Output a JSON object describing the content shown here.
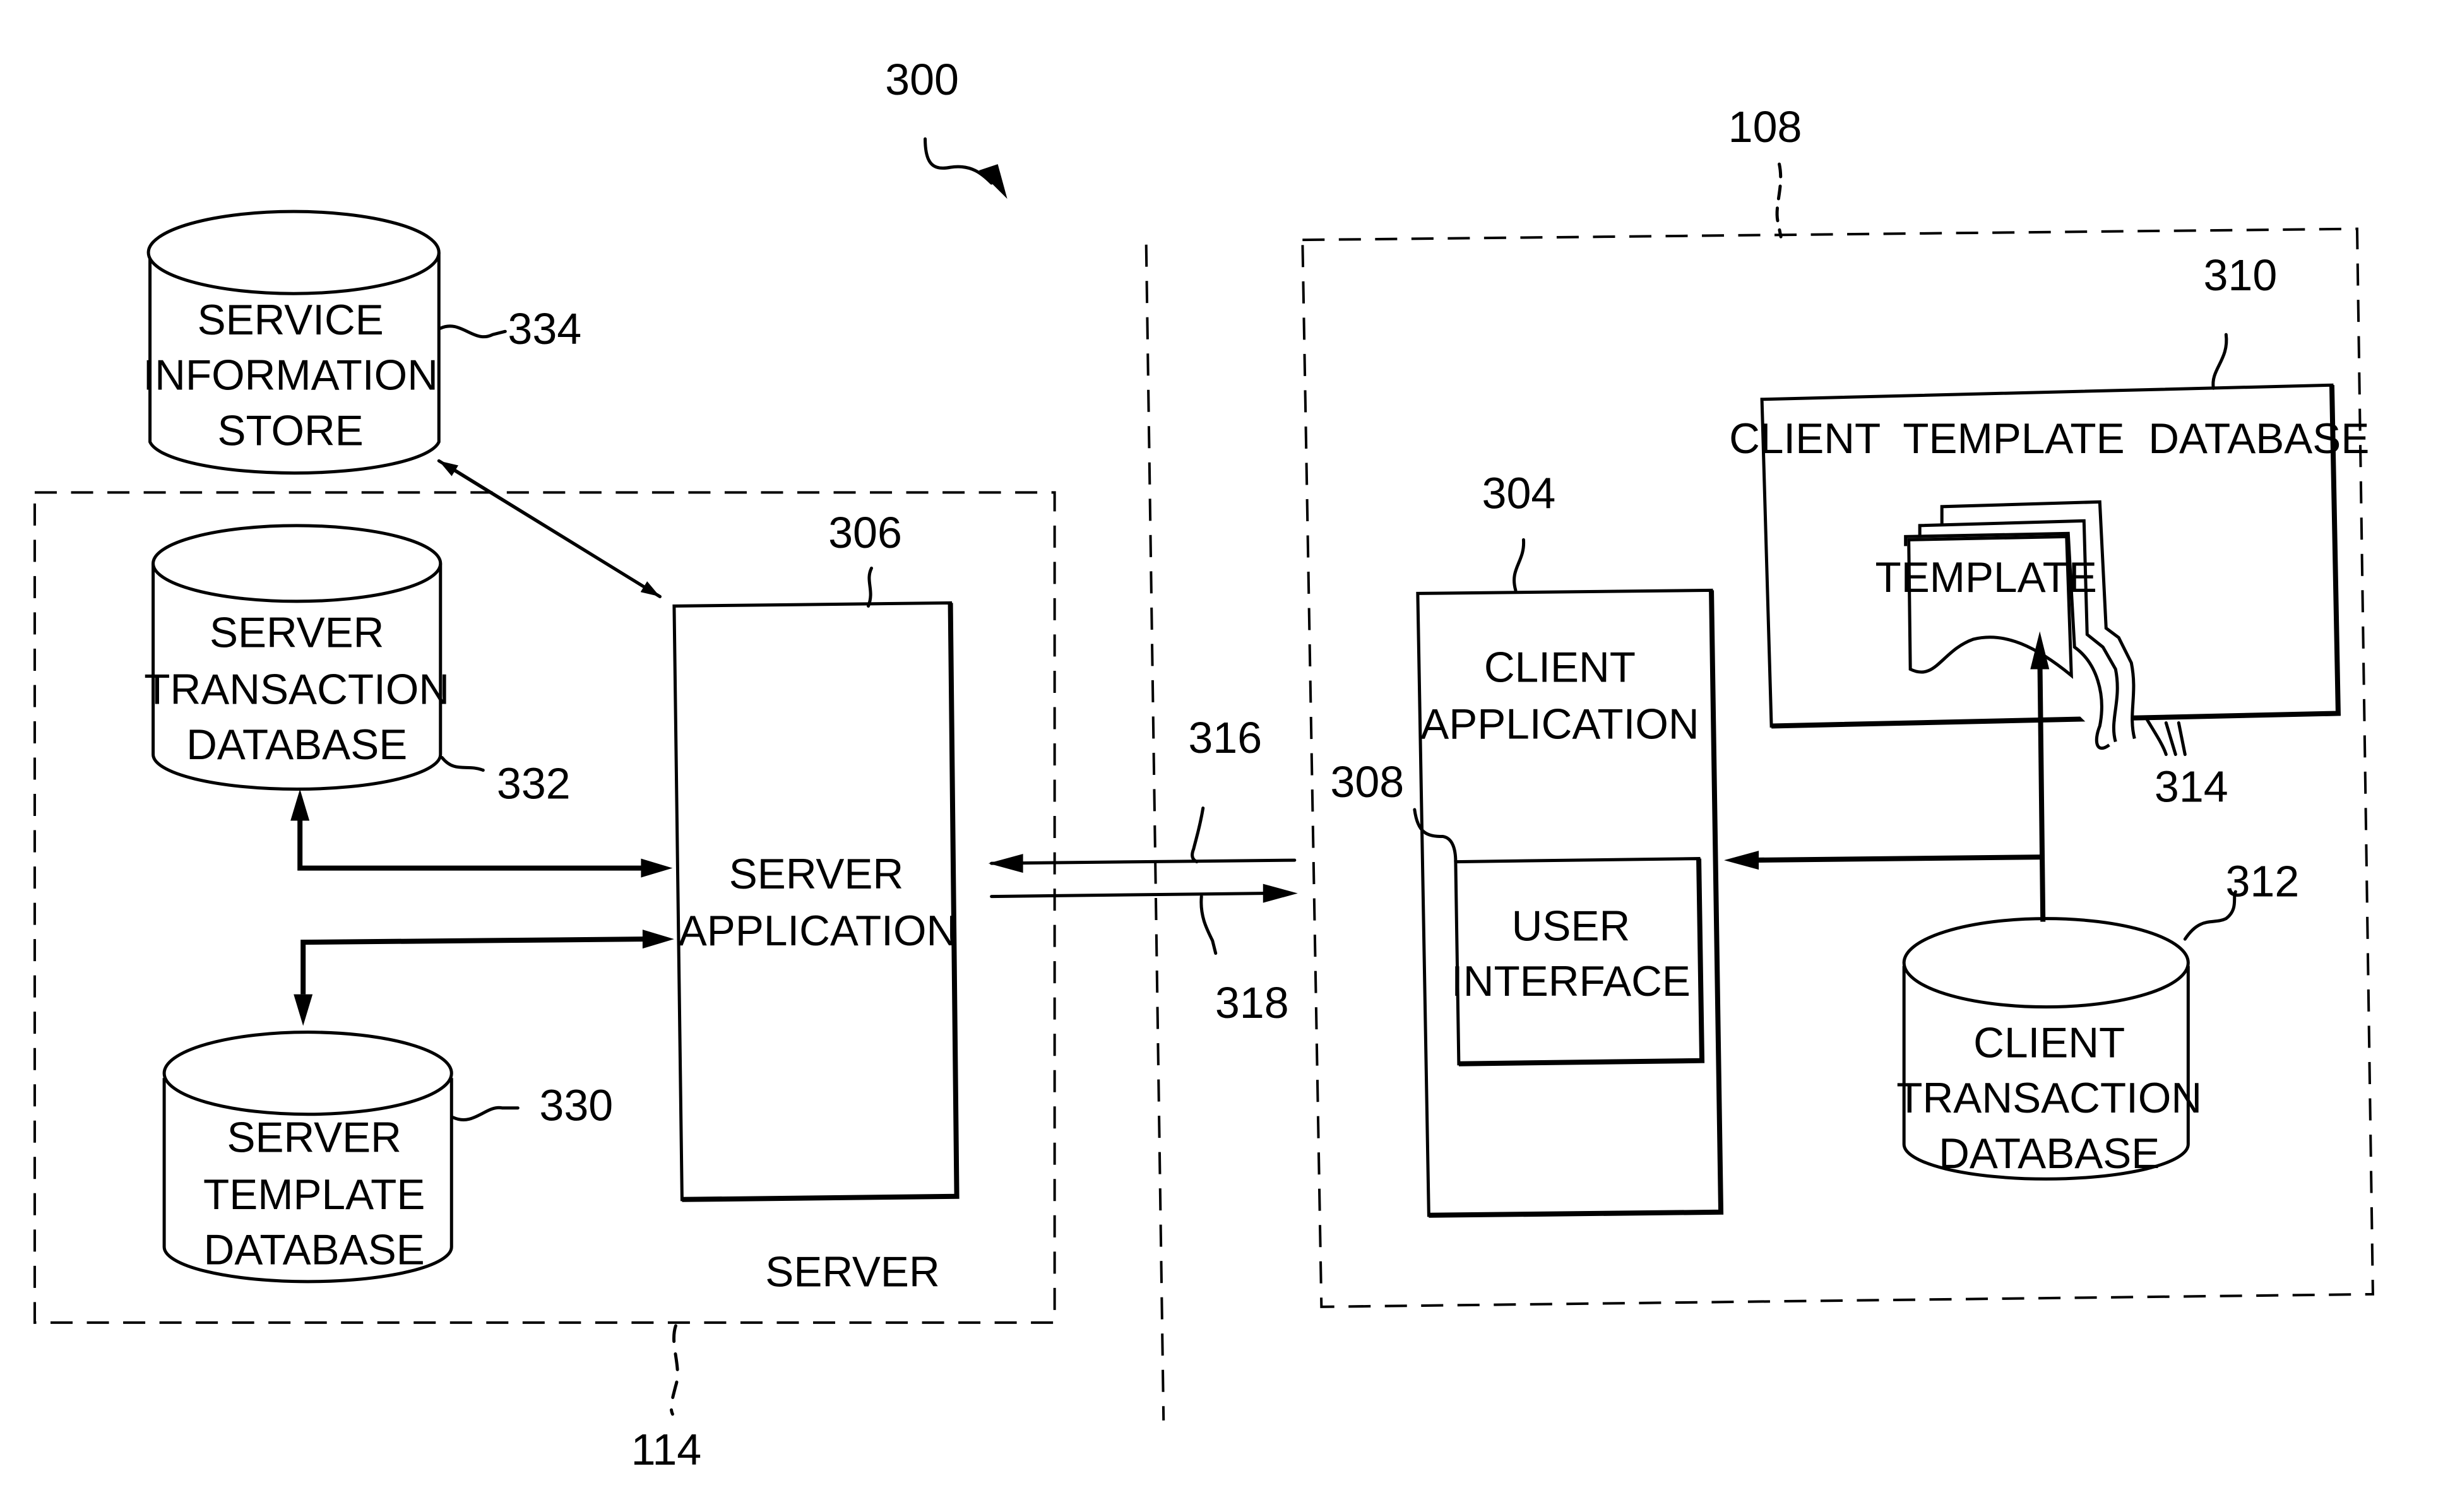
{
  "figure": {
    "ref": "300",
    "client_ref": "108",
    "server_ref": "114"
  },
  "server": {
    "label": "SERVER",
    "service_store": {
      "ref": "334",
      "lines": [
        "SERVICE",
        "INFORMATION",
        "STORE"
      ]
    },
    "transaction_db": {
      "ref": "332",
      "lines": [
        "SERVER",
        "TRANSACTION",
        "DATABASE"
      ]
    },
    "template_db": {
      "ref": "330",
      "lines": [
        "SERVER",
        "TEMPLATE",
        "DATABASE"
      ]
    },
    "application": {
      "ref": "306",
      "lines": [
        "SERVER",
        "APPLICATION"
      ]
    }
  },
  "links": {
    "to_server": "316",
    "to_client": "318"
  },
  "client": {
    "application": {
      "ref": "304",
      "lines": [
        "CLIENT",
        "APPLICATION"
      ]
    },
    "user_interface": {
      "ref": "308",
      "lines": [
        "USER",
        "INTERFACE"
      ]
    },
    "template_db": {
      "ref": "310",
      "title": "CLIENT  TEMPLATE  DATABASE"
    },
    "template": {
      "ref": "314",
      "label": "TEMPLATE"
    },
    "transaction_db": {
      "ref": "312",
      "lines": [
        "CLIENT",
        "TRANSACTION",
        "DATABASE"
      ]
    }
  }
}
